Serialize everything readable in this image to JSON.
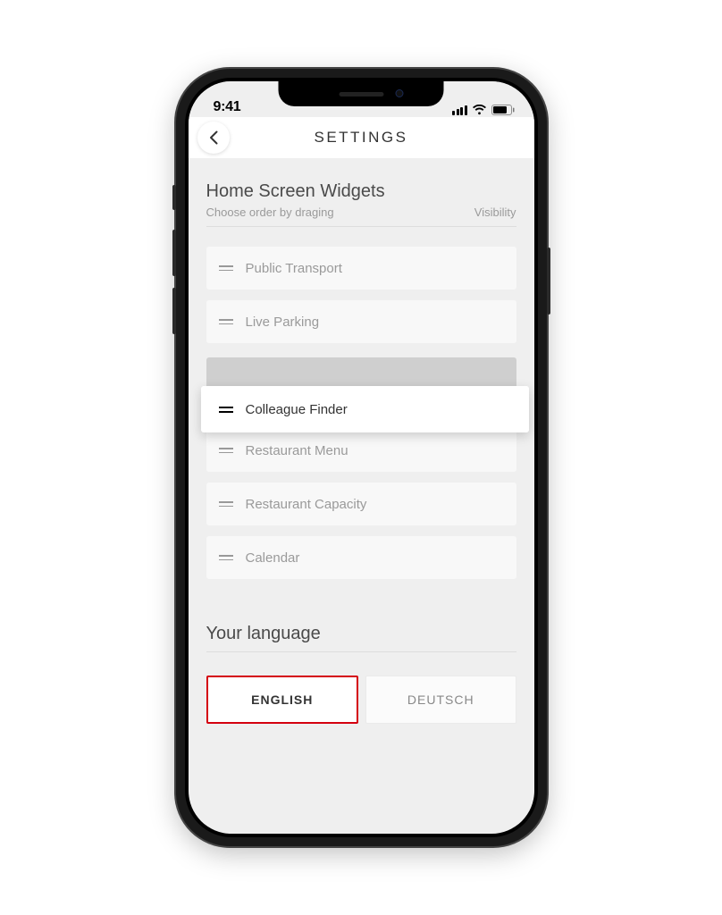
{
  "status": {
    "time": "9:41"
  },
  "header": {
    "title": "SETTINGS"
  },
  "widgets": {
    "title": "Home Screen Widgets",
    "subtitle": "Choose order by draging",
    "visibility_label": "Visibility",
    "items": [
      {
        "label": "Public Transport"
      },
      {
        "label": "Live Parking"
      },
      {
        "label": "Colleague Finder"
      },
      {
        "label": "Restaurant Menu"
      },
      {
        "label": "Restaurant Capacity"
      },
      {
        "label": "Calendar"
      }
    ],
    "dragging_index": 2
  },
  "language": {
    "title": "Your language",
    "options": [
      {
        "label": "ENGLISH",
        "selected": true
      },
      {
        "label": "DEUTSCH",
        "selected": false
      }
    ]
  },
  "colors": {
    "accent": "#d4000f",
    "background": "#efefef",
    "card": "#f8f8f8"
  }
}
